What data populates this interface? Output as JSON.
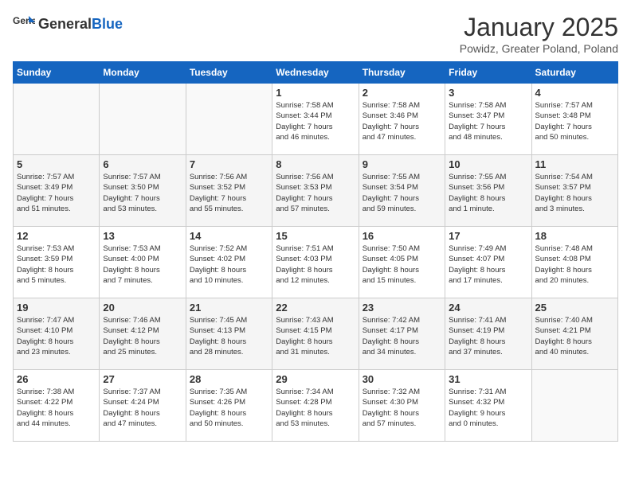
{
  "header": {
    "logo_general": "General",
    "logo_blue": "Blue",
    "title": "January 2025",
    "subtitle": "Powidz, Greater Poland, Poland"
  },
  "days_of_week": [
    "Sunday",
    "Monday",
    "Tuesday",
    "Wednesday",
    "Thursday",
    "Friday",
    "Saturday"
  ],
  "weeks": [
    [
      {
        "day": "",
        "info": ""
      },
      {
        "day": "",
        "info": ""
      },
      {
        "day": "",
        "info": ""
      },
      {
        "day": "1",
        "info": "Sunrise: 7:58 AM\nSunset: 3:44 PM\nDaylight: 7 hours\nand 46 minutes."
      },
      {
        "day": "2",
        "info": "Sunrise: 7:58 AM\nSunset: 3:46 PM\nDaylight: 7 hours\nand 47 minutes."
      },
      {
        "day": "3",
        "info": "Sunrise: 7:58 AM\nSunset: 3:47 PM\nDaylight: 7 hours\nand 48 minutes."
      },
      {
        "day": "4",
        "info": "Sunrise: 7:57 AM\nSunset: 3:48 PM\nDaylight: 7 hours\nand 50 minutes."
      }
    ],
    [
      {
        "day": "5",
        "info": "Sunrise: 7:57 AM\nSunset: 3:49 PM\nDaylight: 7 hours\nand 51 minutes."
      },
      {
        "day": "6",
        "info": "Sunrise: 7:57 AM\nSunset: 3:50 PM\nDaylight: 7 hours\nand 53 minutes."
      },
      {
        "day": "7",
        "info": "Sunrise: 7:56 AM\nSunset: 3:52 PM\nDaylight: 7 hours\nand 55 minutes."
      },
      {
        "day": "8",
        "info": "Sunrise: 7:56 AM\nSunset: 3:53 PM\nDaylight: 7 hours\nand 57 minutes."
      },
      {
        "day": "9",
        "info": "Sunrise: 7:55 AM\nSunset: 3:54 PM\nDaylight: 7 hours\nand 59 minutes."
      },
      {
        "day": "10",
        "info": "Sunrise: 7:55 AM\nSunset: 3:56 PM\nDaylight: 8 hours\nand 1 minute."
      },
      {
        "day": "11",
        "info": "Sunrise: 7:54 AM\nSunset: 3:57 PM\nDaylight: 8 hours\nand 3 minutes."
      }
    ],
    [
      {
        "day": "12",
        "info": "Sunrise: 7:53 AM\nSunset: 3:59 PM\nDaylight: 8 hours\nand 5 minutes."
      },
      {
        "day": "13",
        "info": "Sunrise: 7:53 AM\nSunset: 4:00 PM\nDaylight: 8 hours\nand 7 minutes."
      },
      {
        "day": "14",
        "info": "Sunrise: 7:52 AM\nSunset: 4:02 PM\nDaylight: 8 hours\nand 10 minutes."
      },
      {
        "day": "15",
        "info": "Sunrise: 7:51 AM\nSunset: 4:03 PM\nDaylight: 8 hours\nand 12 minutes."
      },
      {
        "day": "16",
        "info": "Sunrise: 7:50 AM\nSunset: 4:05 PM\nDaylight: 8 hours\nand 15 minutes."
      },
      {
        "day": "17",
        "info": "Sunrise: 7:49 AM\nSunset: 4:07 PM\nDaylight: 8 hours\nand 17 minutes."
      },
      {
        "day": "18",
        "info": "Sunrise: 7:48 AM\nSunset: 4:08 PM\nDaylight: 8 hours\nand 20 minutes."
      }
    ],
    [
      {
        "day": "19",
        "info": "Sunrise: 7:47 AM\nSunset: 4:10 PM\nDaylight: 8 hours\nand 23 minutes."
      },
      {
        "day": "20",
        "info": "Sunrise: 7:46 AM\nSunset: 4:12 PM\nDaylight: 8 hours\nand 25 minutes."
      },
      {
        "day": "21",
        "info": "Sunrise: 7:45 AM\nSunset: 4:13 PM\nDaylight: 8 hours\nand 28 minutes."
      },
      {
        "day": "22",
        "info": "Sunrise: 7:43 AM\nSunset: 4:15 PM\nDaylight: 8 hours\nand 31 minutes."
      },
      {
        "day": "23",
        "info": "Sunrise: 7:42 AM\nSunset: 4:17 PM\nDaylight: 8 hours\nand 34 minutes."
      },
      {
        "day": "24",
        "info": "Sunrise: 7:41 AM\nSunset: 4:19 PM\nDaylight: 8 hours\nand 37 minutes."
      },
      {
        "day": "25",
        "info": "Sunrise: 7:40 AM\nSunset: 4:21 PM\nDaylight: 8 hours\nand 40 minutes."
      }
    ],
    [
      {
        "day": "26",
        "info": "Sunrise: 7:38 AM\nSunset: 4:22 PM\nDaylight: 8 hours\nand 44 minutes."
      },
      {
        "day": "27",
        "info": "Sunrise: 7:37 AM\nSunset: 4:24 PM\nDaylight: 8 hours\nand 47 minutes."
      },
      {
        "day": "28",
        "info": "Sunrise: 7:35 AM\nSunset: 4:26 PM\nDaylight: 8 hours\nand 50 minutes."
      },
      {
        "day": "29",
        "info": "Sunrise: 7:34 AM\nSunset: 4:28 PM\nDaylight: 8 hours\nand 53 minutes."
      },
      {
        "day": "30",
        "info": "Sunrise: 7:32 AM\nSunset: 4:30 PM\nDaylight: 8 hours\nand 57 minutes."
      },
      {
        "day": "31",
        "info": "Sunrise: 7:31 AM\nSunset: 4:32 PM\nDaylight: 9 hours\nand 0 minutes."
      },
      {
        "day": "",
        "info": ""
      }
    ]
  ]
}
